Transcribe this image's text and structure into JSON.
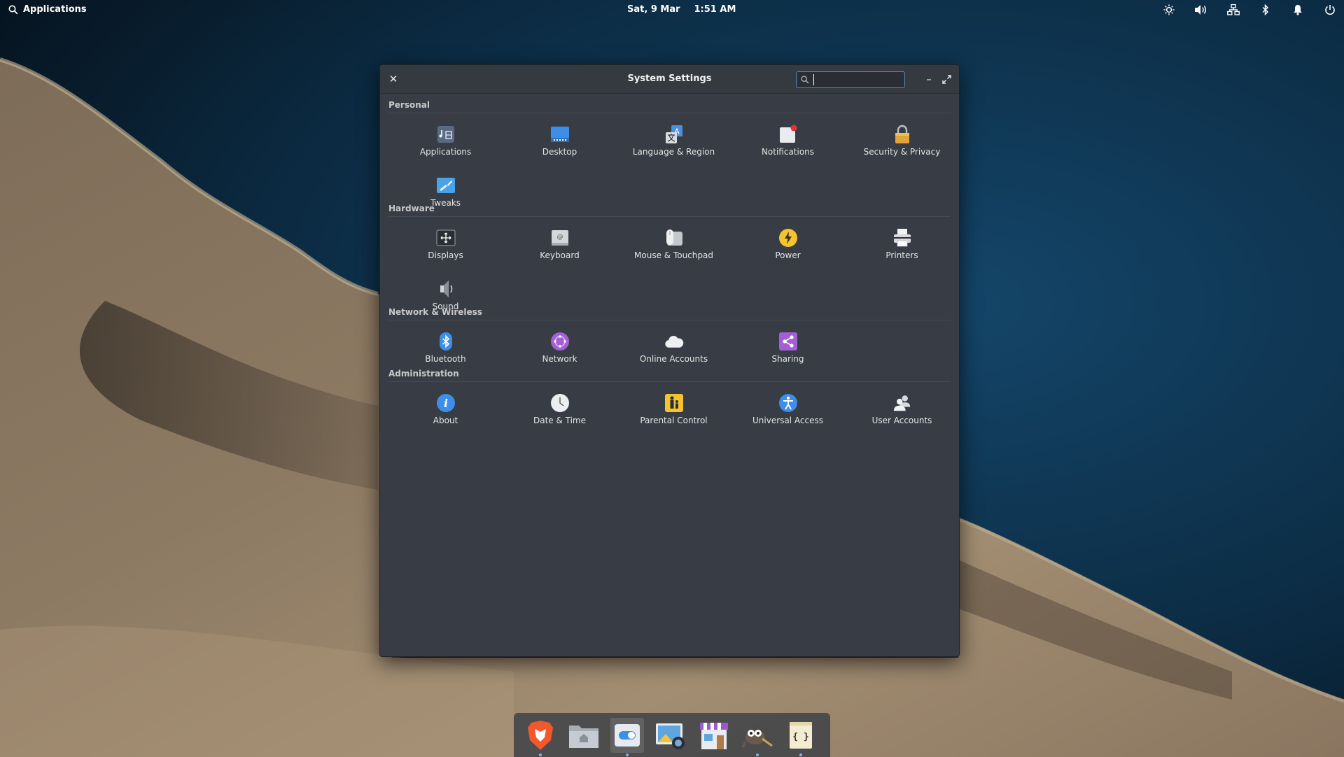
{
  "topbar": {
    "applications_label": "Applications",
    "date": "Sat,  9 Mar",
    "time": "1:51 AM",
    "indicators": [
      "brightness-icon",
      "volume-icon",
      "network-wired-icon",
      "bluetooth-icon",
      "notifications-icon",
      "power-icon"
    ]
  },
  "window": {
    "title": "System Settings",
    "search_value": "",
    "sections": [
      {
        "name": "Personal",
        "items": [
          {
            "label": "Applications",
            "icon": "applications-icon"
          },
          {
            "label": "Desktop",
            "icon": "desktop-icon"
          },
          {
            "label": "Language & Region",
            "icon": "language-region-icon"
          },
          {
            "label": "Notifications",
            "icon": "notifications-icon"
          },
          {
            "label": "Security & Privacy",
            "icon": "lock-icon"
          },
          {
            "label": "Tweaks",
            "icon": "tweaks-icon"
          }
        ]
      },
      {
        "name": "Hardware",
        "items": [
          {
            "label": "Displays",
            "icon": "displays-icon"
          },
          {
            "label": "Keyboard",
            "icon": "keyboard-icon"
          },
          {
            "label": "Mouse & Touchpad",
            "icon": "mouse-icon"
          },
          {
            "label": "Power",
            "icon": "power-bolt-icon"
          },
          {
            "label": "Printers",
            "icon": "printer-icon"
          },
          {
            "label": "Sound",
            "icon": "speaker-icon"
          }
        ]
      },
      {
        "name": "Network & Wireless",
        "items": [
          {
            "label": "Bluetooth",
            "icon": "bluetooth-icon"
          },
          {
            "label": "Network",
            "icon": "network-globe-icon"
          },
          {
            "label": "Online Accounts",
            "icon": "cloud-icon"
          },
          {
            "label": "Sharing",
            "icon": "share-icon"
          }
        ]
      },
      {
        "name": "Administration",
        "items": [
          {
            "label": "About",
            "icon": "info-icon"
          },
          {
            "label": "Date & Time",
            "icon": "clock-icon"
          },
          {
            "label": "Parental Control",
            "icon": "parental-control-icon"
          },
          {
            "label": "Universal Access",
            "icon": "accessibility-icon"
          },
          {
            "label": "User Accounts",
            "icon": "users-icon"
          }
        ]
      }
    ]
  },
  "dock": {
    "items": [
      {
        "icon": "brave-browser-icon",
        "running": true
      },
      {
        "icon": "files-icon",
        "running": false
      },
      {
        "icon": "system-settings-icon",
        "running": true
      },
      {
        "icon": "photos-icon",
        "running": false
      },
      {
        "icon": "appcenter-icon",
        "running": false
      },
      {
        "icon": "gimp-icon",
        "running": true
      },
      {
        "icon": "code-editor-icon",
        "running": true
      }
    ]
  }
}
